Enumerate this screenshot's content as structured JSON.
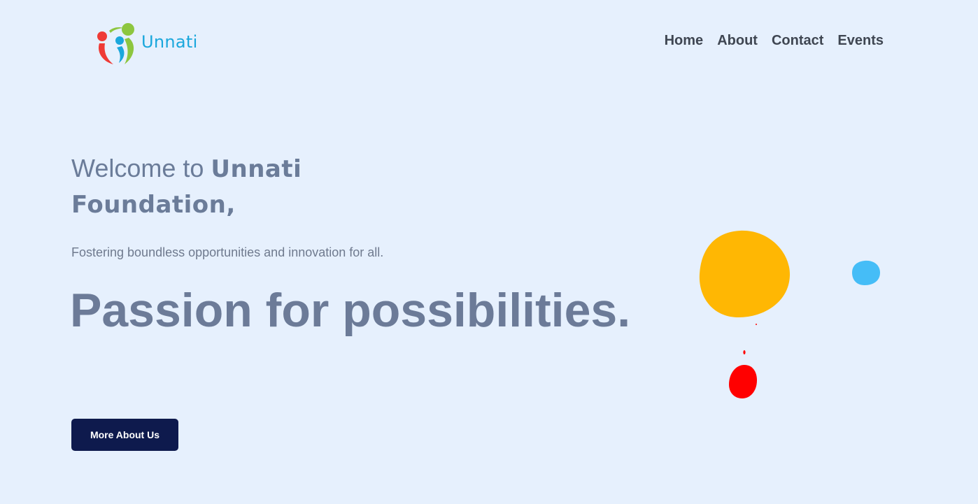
{
  "header": {
    "logo_text": "Unnati",
    "nav": [
      {
        "label": "Home"
      },
      {
        "label": "About"
      },
      {
        "label": "Contact"
      },
      {
        "label": "Events"
      }
    ]
  },
  "hero": {
    "welcome_prefix": "Welcome to ",
    "welcome_brand": "Unnati Foundation,",
    "tagline": "Fostering boundless opportunities and innovation for all.",
    "headline": "Passion for possibilities.",
    "cta_label": "More About Us"
  },
  "colors": {
    "background": "#e6f0fd",
    "logo_text": "#1aa7dc",
    "cta_background": "#0e1a4d",
    "blob_yellow": "#ffb703",
    "blob_blue": "#45bdf7",
    "blob_red": "#ff0000"
  }
}
